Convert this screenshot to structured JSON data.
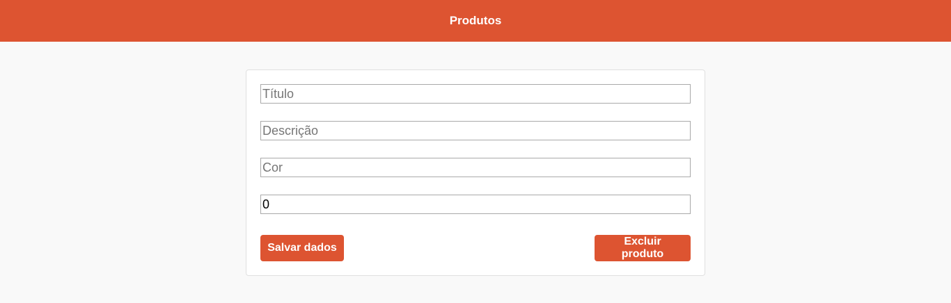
{
  "header": {
    "title": "Produtos"
  },
  "form": {
    "titulo": {
      "placeholder": "Título",
      "value": ""
    },
    "descricao": {
      "placeholder": "Descrição",
      "value": ""
    },
    "cor": {
      "placeholder": "Cor",
      "value": ""
    },
    "preco": {
      "placeholder": "",
      "value": "0"
    }
  },
  "actions": {
    "save_label": "Salvar dados",
    "delete_label": "Excluir produto"
  },
  "colors": {
    "accent": "#dd5431",
    "background": "#f9f9f9",
    "card": "#ffffff"
  }
}
